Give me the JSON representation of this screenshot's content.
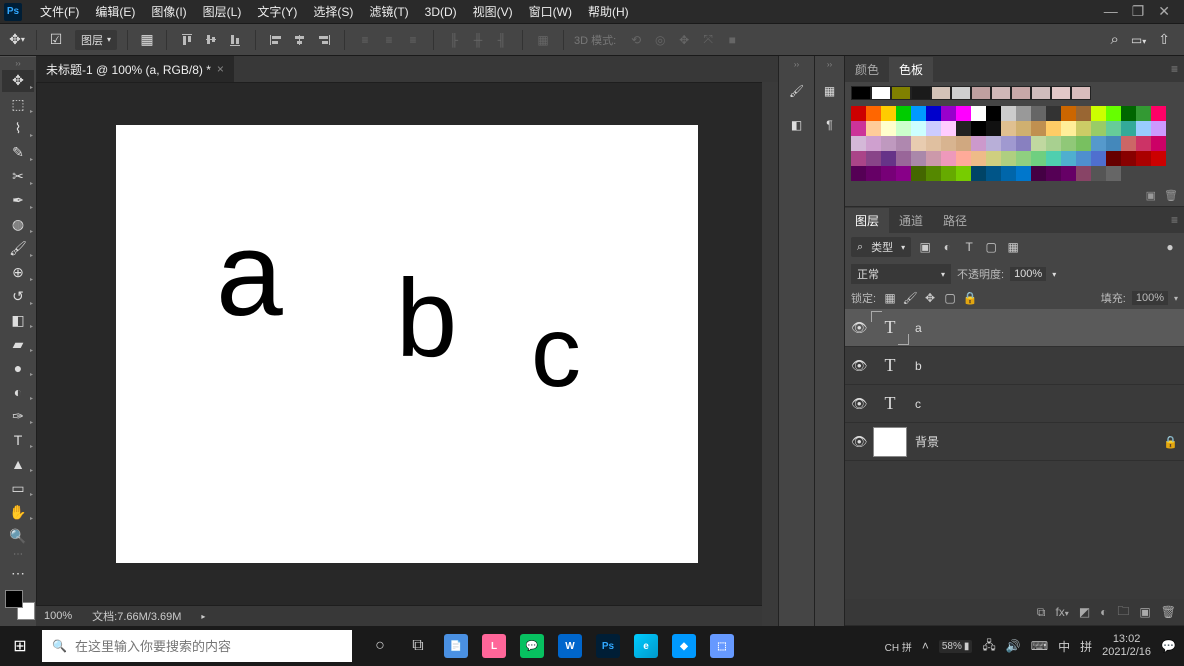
{
  "menubar": {
    "items": [
      "文件(F)",
      "编辑(E)",
      "图像(I)",
      "图层(L)",
      "文字(Y)",
      "选择(S)",
      "滤镜(T)",
      "3D(D)",
      "视图(V)",
      "窗口(W)",
      "帮助(H)"
    ]
  },
  "options": {
    "layer_select_label": "图层",
    "threeD_label": "3D 模式:"
  },
  "document": {
    "tab_title": "未标题-1 @ 100% (a, RGB/8) *",
    "canvas_text_a": "a",
    "canvas_text_b": "b",
    "canvas_text_c": "c"
  },
  "color_panel": {
    "tabs": [
      "颜色",
      "色板"
    ],
    "active_tab": 1,
    "row1": [
      "#000000",
      "#ffffff",
      "#808000",
      "#1a1a1a",
      "#d4c3b8",
      "#cfcfcf",
      "#bfa0a0",
      "#d0b8b8",
      "#c8a8a8",
      "#cfbcbc",
      "#e2c8c8",
      "#d8bcbc"
    ],
    "grid": [
      "#cc0000",
      "#ff6600",
      "#ffcc00",
      "#00cc00",
      "#0099ff",
      "#0000cc",
      "#9900cc",
      "#ff00ff",
      "#ffffff",
      "#000000",
      "#cccccc",
      "#999999",
      "#666666",
      "#333333",
      "#cc6600",
      "#996633",
      "#ccff00",
      "#66ff00",
      "#006600",
      "#339933",
      "#ff0066",
      "#cc3399",
      "#ffcc99",
      "#ffffcc",
      "#ccffcc",
      "#ccffff",
      "#ccccff",
      "#ffccff",
      "#222222",
      "#000000",
      "#111111",
      "#e0c090",
      "#d0b070",
      "#c09050",
      "#ffcc66",
      "#ffee99",
      "#cccc66",
      "#99cc66",
      "#66cc99",
      "#33aa99",
      "#99ccff",
      "#cc99ff",
      "#d4b8d8",
      "#cfa0cf",
      "#bf99bf",
      "#af88af",
      "#e8ccb0",
      "#e0c0a0",
      "#d8b490",
      "#d0a880",
      "#cc99cc",
      "#b8afd8",
      "#a099d0",
      "#8880c0",
      "#c0d8a0",
      "#a8d090",
      "#90c878",
      "#78c060",
      "#5599cc",
      "#4488bb",
      "#cc6666",
      "#cc3366",
      "#cc0066",
      "#aa4488",
      "#884488",
      "#663388",
      "#996699",
      "#aa88aa",
      "#cc99aa",
      "#ee99bb",
      "#ffaa99",
      "#eebb88",
      "#cfcf80",
      "#afcf80",
      "#8fcf80",
      "#6fcf80",
      "#4fcfaf",
      "#4fafcf",
      "#4f8fcf",
      "#4f6fcf",
      "#660000",
      "#880000",
      "#aa0000",
      "#cc0000",
      "#550055",
      "#660066",
      "#770077",
      "#880088",
      "#446600",
      "#558800",
      "#66aa00",
      "#77cc00",
      "#004466",
      "#005588",
      "#0066aa",
      "#0077cc",
      "#440044",
      "#550055",
      "#660066",
      "#884466",
      "#555555",
      "#666666"
    ]
  },
  "layers_panel": {
    "tabs": [
      "图层",
      "通道",
      "路径"
    ],
    "active_tab": 0,
    "type_filter_label": "类型",
    "blend_mode": "正常",
    "opacity_label": "不透明度:",
    "opacity_value": "100%",
    "lock_label": "锁定:",
    "fill_label": "填充:",
    "fill_value": "100%",
    "layers": [
      {
        "name": "a",
        "type": "text",
        "selected": true,
        "visible": true
      },
      {
        "name": "b",
        "type": "text",
        "selected": false,
        "visible": true
      },
      {
        "name": "c",
        "type": "text",
        "selected": false,
        "visible": true
      },
      {
        "name": "背景",
        "type": "bg",
        "selected": false,
        "visible": true,
        "locked": true
      }
    ]
  },
  "statusbar": {
    "zoom": "100%",
    "doc_info": "文档:7.66M/3.69M"
  },
  "taskbar": {
    "search_placeholder": "在这里输入你要搜索的内容",
    "ime1": "CH",
    "ime2": "拼",
    "battery": "58%",
    "ime3": "中",
    "ime4": "拼",
    "time": "13:02",
    "date": "2021/2/16"
  }
}
